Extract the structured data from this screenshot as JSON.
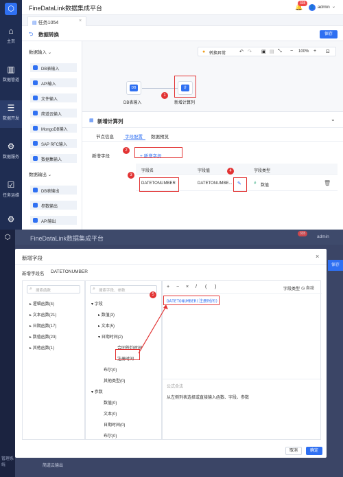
{
  "app_title": "FineDataLink数据集成平台",
  "notification_count": "335",
  "user": "admin",
  "nav": [
    {
      "label": "主页",
      "icon": "home-icon"
    },
    {
      "label": "数据管道",
      "icon": "pipeline-icon"
    },
    {
      "label": "数据开发",
      "icon": "dev-icon"
    },
    {
      "label": "数据服务",
      "icon": "service-icon"
    },
    {
      "label": "任务运维",
      "icon": "ops-icon"
    },
    {
      "label": "",
      "icon": "gear-icon"
    }
  ],
  "tab_label": "任务1054",
  "page_title": "数据转换",
  "save_label": "保存",
  "toolbar": {
    "exception": "转换异常",
    "zoom": "100%"
  },
  "left_panel": {
    "input_group": "数据输入",
    "inputs": [
      "DB表输入",
      "API输入",
      "文件输入",
      "简道云输入",
      "MongoDB输入",
      "SAP RFC输入",
      "数据集输入"
    ],
    "output_group": "数据输出",
    "outputs": [
      "DB表输出",
      "参数输出",
      "API输出"
    ]
  },
  "canvas": {
    "node1": "DB表输入",
    "node2": "新增计算列",
    "node2_icon_text": "计"
  },
  "props": {
    "title": "新增计算列",
    "tabs": [
      "节点信息",
      "字段配置",
      "数据预览"
    ],
    "new_field_label": "新增字段",
    "add_field_btn": "+ 新增字段",
    "columns": [
      "字段名",
      "字段值",
      "字段类型"
    ],
    "row": {
      "name": "DATETONUMBER",
      "value": "DATETONUMBE...",
      "type": "数值",
      "type_icon": "#"
    }
  },
  "markers": [
    "1",
    "2",
    "3",
    "4",
    "5"
  ],
  "modal": {
    "title": "新增字段",
    "field_name_label": "新增字段名",
    "field_name": "DATETONUMBER",
    "search_func": "搜索函数",
    "search_field": "搜索字段、参数",
    "func_tree": [
      "逻辑函数(4)",
      "文本函数(21)",
      "日期函数(17)",
      "数值函数(23)",
      "其他函数(1)"
    ],
    "field_tree": {
      "field": "字段",
      "field_children": [
        "数值(3)",
        "文本(5)",
        "日期时间(2)"
      ],
      "date_children": [
        "合同签约时间",
        "注册时间"
      ],
      "rest": [
        "布尔(0)",
        "其他类型(0)"
      ],
      "param": "参数",
      "param_children": [
        "数值(0)",
        "文本(0)",
        "日期时间(0)",
        "布尔(0)"
      ]
    },
    "ops": [
      "+",
      "−",
      "×",
      "/",
      "(",
      ")"
    ],
    "field_type_label": "字段类型",
    "auto_label": "自动",
    "formula": "DATETONUMBER(注册时间)",
    "formula_fn": "DATETONUMBER(",
    "formula_arg": "注册时间",
    "formula_close": ")",
    "tips_title": "公式合法",
    "tips": "从左侧列表选择或直接输入函数、字段、参数",
    "cancel": "取消",
    "ok": "确定"
  },
  "bottom_hint": {
    "item": "简道云输出",
    "nav": "管理系统"
  },
  "dim_save": "保存"
}
